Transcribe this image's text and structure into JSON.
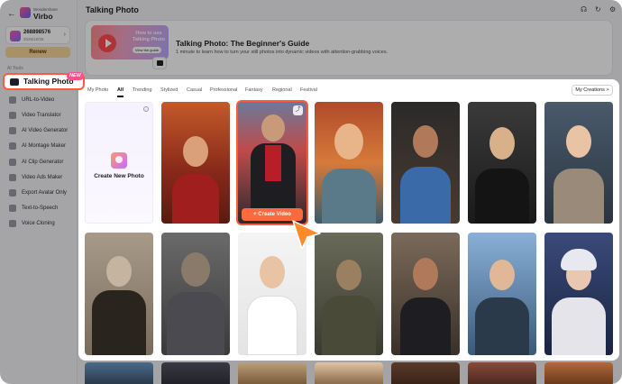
{
  "app": {
    "brand_small": "Wondershare",
    "brand": "Virbo"
  },
  "account": {
    "id": "268898576",
    "date": "2025/10/28",
    "renew_label": "Renew"
  },
  "sidebar": {
    "section_label": "AI Tools",
    "active_item": {
      "label": "Talking Photo",
      "badge": "NEW"
    },
    "items": [
      {
        "label": "URL-to-Video"
      },
      {
        "label": "Video Translator"
      },
      {
        "label": "AI Video Generator"
      },
      {
        "label": "AI Montage Maker"
      },
      {
        "label": "AI Clip Generator"
      },
      {
        "label": "Video Ads Maker"
      },
      {
        "label": "Export Avatar Only"
      },
      {
        "label": "Text-to-Speech"
      },
      {
        "label": "Voice Cloning"
      }
    ]
  },
  "header": {
    "title": "Talking Photo"
  },
  "banner": {
    "thumb_title": "How to use Talking Photo",
    "thumb_button": "View the guide",
    "title": "Talking Photo: The Beginner's Guide",
    "description": "1 minute to learn how to turn your still photos into dynamic videos with attention-grabbing voices."
  },
  "filters": {
    "tabs": [
      "My Photo",
      "All",
      "Trending",
      "Stylized",
      "Casual",
      "Professional",
      "Fantasy",
      "Regional",
      "Festival"
    ],
    "active": "All",
    "my_creations": "My Creations >"
  },
  "grid": {
    "create_label": "Create New Photo",
    "info_icon": "info-icon",
    "create_video_label": "+ Create Video",
    "selected_card": 1
  },
  "colors": {
    "accent": "#ff5a3c",
    "badge": "#ff4f8b",
    "cta": "#ff6a3d"
  }
}
